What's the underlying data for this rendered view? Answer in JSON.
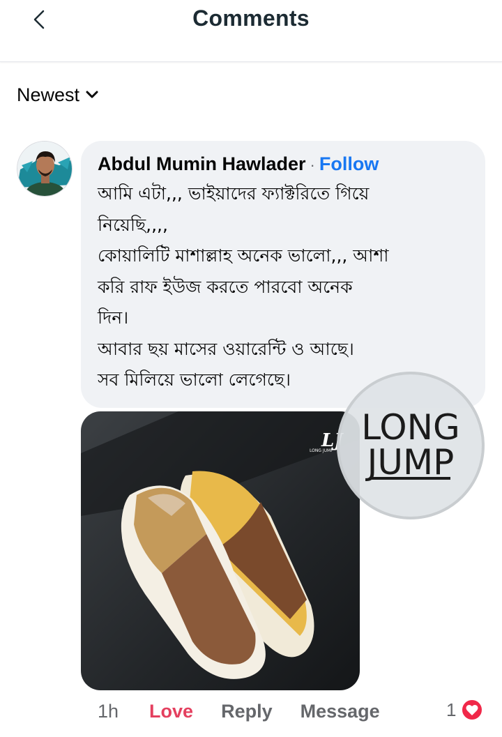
{
  "header": {
    "title": "Comments",
    "back_icon": "chevron-left-icon"
  },
  "sort": {
    "label": "Newest",
    "icon": "chevron-down-icon"
  },
  "comment": {
    "author": "Abdul Mumin Hawlader",
    "separator": "·",
    "follow_label": "Follow",
    "lines": [
      "আমি এটা,,, ভাইয়াদের ফ্যাক্টরিতে গিয়ে",
      "নিয়েছি,,,,",
      "কোয়ালিটি মাশাল্লাহ অনেক ভালো,,, আশা",
      "করি রাফ ইউজ করতে পারবো অনেক",
      "দিন।",
      "আবার ছয় মাসের ওয়ারেন্টি ও আছে।",
      "সব মিলিয়ে ভালো লেগেছে।"
    ],
    "photo": {
      "brand_logo": "LJ",
      "brand_logo_caption": "LONG JUMP"
    },
    "watermark": {
      "line1": "LONG",
      "line2": "JUMP"
    },
    "actions": {
      "time": "1h",
      "love_label": "Love",
      "reply_label": "Reply",
      "message_label": "Message"
    },
    "reactions": {
      "count": "1",
      "icon": "heart-icon",
      "color": "#f02849"
    }
  },
  "colors": {
    "accent": "#1877f2",
    "love": "#e4405f",
    "bubble": "#f0f2f5",
    "muted": "#65676b"
  }
}
